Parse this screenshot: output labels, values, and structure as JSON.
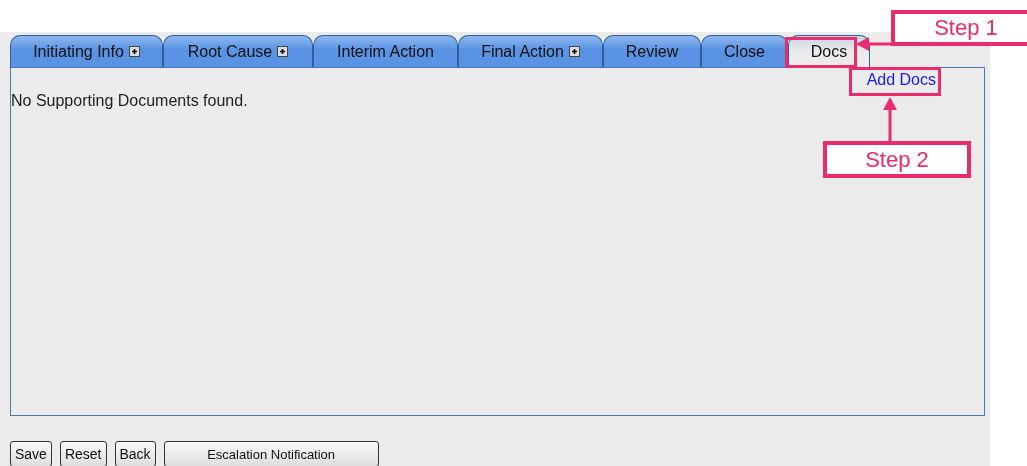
{
  "tabs": [
    {
      "label": "Initiating Info",
      "expander": true,
      "selected": false
    },
    {
      "label": "Root Cause",
      "expander": true,
      "selected": false
    },
    {
      "label": "Interim Action",
      "expander": false,
      "selected": false
    },
    {
      "label": "Final Action",
      "expander": true,
      "selected": false
    },
    {
      "label": "Review",
      "expander": false,
      "selected": false
    },
    {
      "label": "Close",
      "expander": false,
      "selected": false
    },
    {
      "label": "Docs",
      "expander": false,
      "selected": true
    }
  ],
  "add_link": "Add Docs",
  "message": "No Supporting Documents found.",
  "buttons": [
    "Save",
    "Reset",
    "Back",
    "Escalation Notification"
  ],
  "callouts": [
    "Step 1",
    "Step 2"
  ]
}
